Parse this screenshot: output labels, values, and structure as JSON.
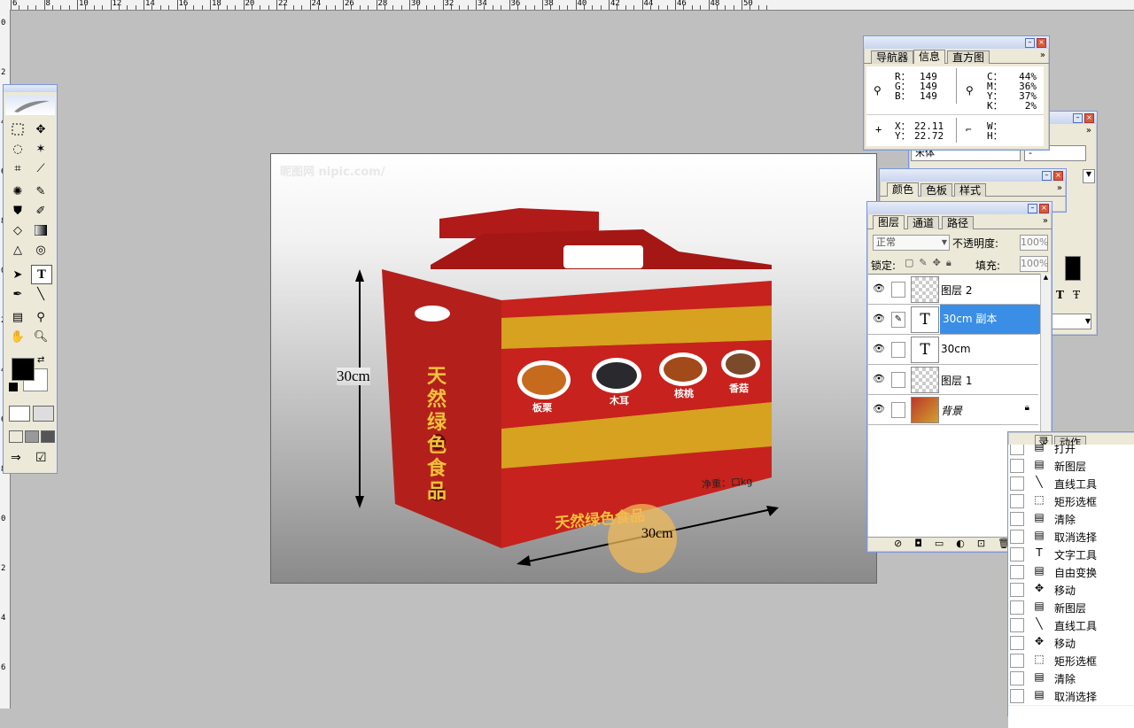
{
  "ruler_top_labels": [
    "6",
    "8",
    "10",
    "12",
    "14",
    "16",
    "18",
    "20",
    "22",
    "24",
    "26",
    "28",
    "30",
    "32",
    "34",
    "36",
    "38",
    "40",
    "42",
    "44",
    "46",
    "48",
    "50"
  ],
  "ruler_left_labels": [
    "0",
    "2",
    "4",
    "6",
    "8",
    "0",
    "2",
    "4",
    "6",
    "8",
    "0",
    "2",
    "4",
    "6"
  ],
  "canvas": {
    "watermark": "昵图网 nipic.com/",
    "height_label": "30cm",
    "width_label": "30cm",
    "box": {
      "brand_vertical": "天然绿色食品",
      "brand_bottom": "天然绿色食品",
      "net_weight": "净重：口kg",
      "products": [
        "板栗",
        "木耳",
        "核桃",
        "香菇"
      ]
    }
  },
  "info_panel": {
    "tabs": [
      "导航器",
      "信息",
      "直方图"
    ],
    "active_tab": "信息",
    "rgb": {
      "r_label": "R：",
      "g_label": "G：",
      "b_label": "B：",
      "r": "149",
      "g": "149",
      "b": "149"
    },
    "cmyk": {
      "c_label": "C：",
      "m_label": "M：",
      "y_label": "Y：",
      "k_label": "K：",
      "c": "44%",
      "m": "36%",
      "y": "37%",
      "k": "2%"
    },
    "xy": {
      "x_label": "X：",
      "y_label": "Y：",
      "x": "22.11",
      "y": "22.72"
    },
    "wh": {
      "w_label": "W：",
      "h_label": "H："
    }
  },
  "char_panel": {
    "font": "宋体",
    "style": "-"
  },
  "color_panel": {
    "tabs": [
      "颜色",
      "色板",
      "样式"
    ],
    "active_tab": "颜色"
  },
  "layers_panel": {
    "tabs": [
      "图层",
      "通道",
      "路径"
    ],
    "active_tab": "图层",
    "blend_mode": "正常",
    "opacity_label": "不透明度:",
    "opacity": "100%",
    "lock_label": "锁定:",
    "fill_label": "填充:",
    "fill": "100%",
    "layers": [
      {
        "name": "图层 2",
        "thumb": "checker",
        "selected": false
      },
      {
        "name": "30cm 副本",
        "thumb": "text",
        "selected": true
      },
      {
        "name": "30cm",
        "thumb": "text",
        "selected": false
      },
      {
        "name": "图层 1",
        "thumb": "checker",
        "selected": false
      },
      {
        "name": "背景",
        "thumb": "image",
        "selected": false
      }
    ],
    "text_thumb_glyph": "T"
  },
  "history_panel": {
    "tabs": [
      "录",
      "动作"
    ],
    "items": [
      {
        "icon": "doc-icon",
        "label": "打开"
      },
      {
        "icon": "doc-icon",
        "label": "新图层"
      },
      {
        "icon": "line-icon",
        "label": "直线工具"
      },
      {
        "icon": "marquee-icon",
        "label": "矩形选框"
      },
      {
        "icon": "doc-icon",
        "label": "清除"
      },
      {
        "icon": "doc-icon",
        "label": "取消选择"
      },
      {
        "icon": "text-icon",
        "label": "文字工具"
      },
      {
        "icon": "doc-icon",
        "label": "自由变换"
      },
      {
        "icon": "move-icon",
        "label": "移动"
      },
      {
        "icon": "doc-icon",
        "label": "新图层"
      },
      {
        "icon": "line-icon",
        "label": "直线工具"
      },
      {
        "icon": "move-icon",
        "label": "移动"
      },
      {
        "icon": "marquee-icon",
        "label": "矩形选框"
      },
      {
        "icon": "doc-icon",
        "label": "清除"
      },
      {
        "icon": "doc-icon",
        "label": "取消选择"
      }
    ]
  },
  "colors": {
    "selection_blue": "#3a8ee6",
    "box_red": "#c0201c",
    "band_gold": "#d8a520",
    "foreground": "#000000",
    "background": "#ffffff"
  }
}
